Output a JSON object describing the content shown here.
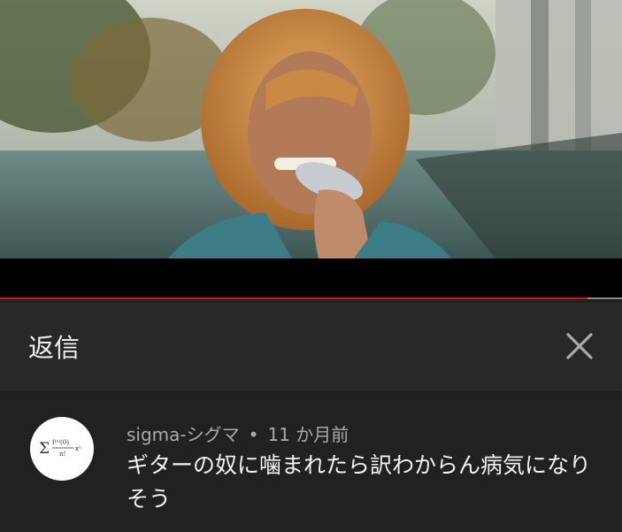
{
  "video": {
    "progress_percent": 94.5,
    "colors": {
      "played": "#d11212",
      "buffered": "#8a8a8a"
    }
  },
  "replies_panel": {
    "title": "返信",
    "close_icon": "close-icon"
  },
  "comment": {
    "author": "sigma-シグマ",
    "separator": "•",
    "time": "11 か月前",
    "text": "ギターの奴に噛まれたら訳わからん病気になりそう",
    "avatar_icon": "sigma-formula-avatar"
  },
  "colors": {
    "background": "#212121",
    "header": "#282828",
    "text_primary": "#f1f1f1",
    "text_secondary": "#aaaaaa"
  }
}
